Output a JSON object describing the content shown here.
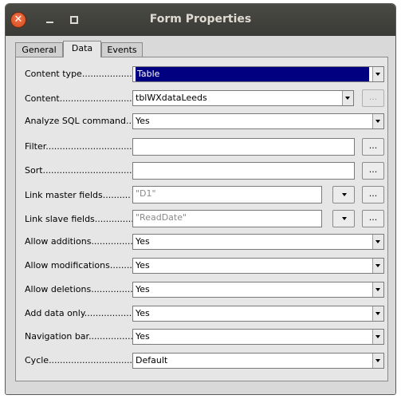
{
  "window": {
    "title": "Form Properties"
  },
  "tabs": [
    {
      "label": "General",
      "active": false
    },
    {
      "label": "Data",
      "active": true
    },
    {
      "label": "Events",
      "active": false
    }
  ],
  "fields": {
    "content_type": {
      "label": "Content type",
      "dots": "......................",
      "value": "Table"
    },
    "content": {
      "label": "Content",
      "dots": "................................",
      "value": "tblWXdataLeeds",
      "button": "..."
    },
    "analyze_sql": {
      "label": "Analyze SQL command...",
      "value": "Yes"
    },
    "filter": {
      "label": "Filter",
      "dots": "...................................",
      "value": "",
      "button": "..."
    },
    "sort": {
      "label": "Sort",
      "dots": ".......................................",
      "value": "",
      "button": "..."
    },
    "link_master": {
      "label": "Link master fields",
      "dots": "..........",
      "value": "\"D1\"",
      "button": "..."
    },
    "link_slave": {
      "label": "Link slave fields",
      "dots": "..............",
      "value": "\"ReadDate\"",
      "button": "..."
    },
    "allow_additions": {
      "label": "Allow additions",
      "dots": "..................",
      "value": "Yes"
    },
    "allow_modifications": {
      "label": "Allow modifications",
      "dots": "..........",
      "value": "Yes"
    },
    "allow_deletions": {
      "label": "Allow deletions",
      "dots": "..................",
      "value": "Yes"
    },
    "add_data_only": {
      "label": "Add data only",
      "dots": ".....................",
      "value": "Yes"
    },
    "navigation_bar": {
      "label": "Navigation bar",
      "dots": ".................",
      "value": "Yes"
    },
    "cycle": {
      "label": "Cycle",
      "dots": "......................................",
      "value": "Default"
    }
  },
  "icons": {
    "close": "close-icon",
    "minimize": "minimize-icon",
    "maximize": "maximize-icon"
  },
  "colors": {
    "selection": "#000080",
    "titlebar": "#3c3b37",
    "close": "#e9541f"
  }
}
